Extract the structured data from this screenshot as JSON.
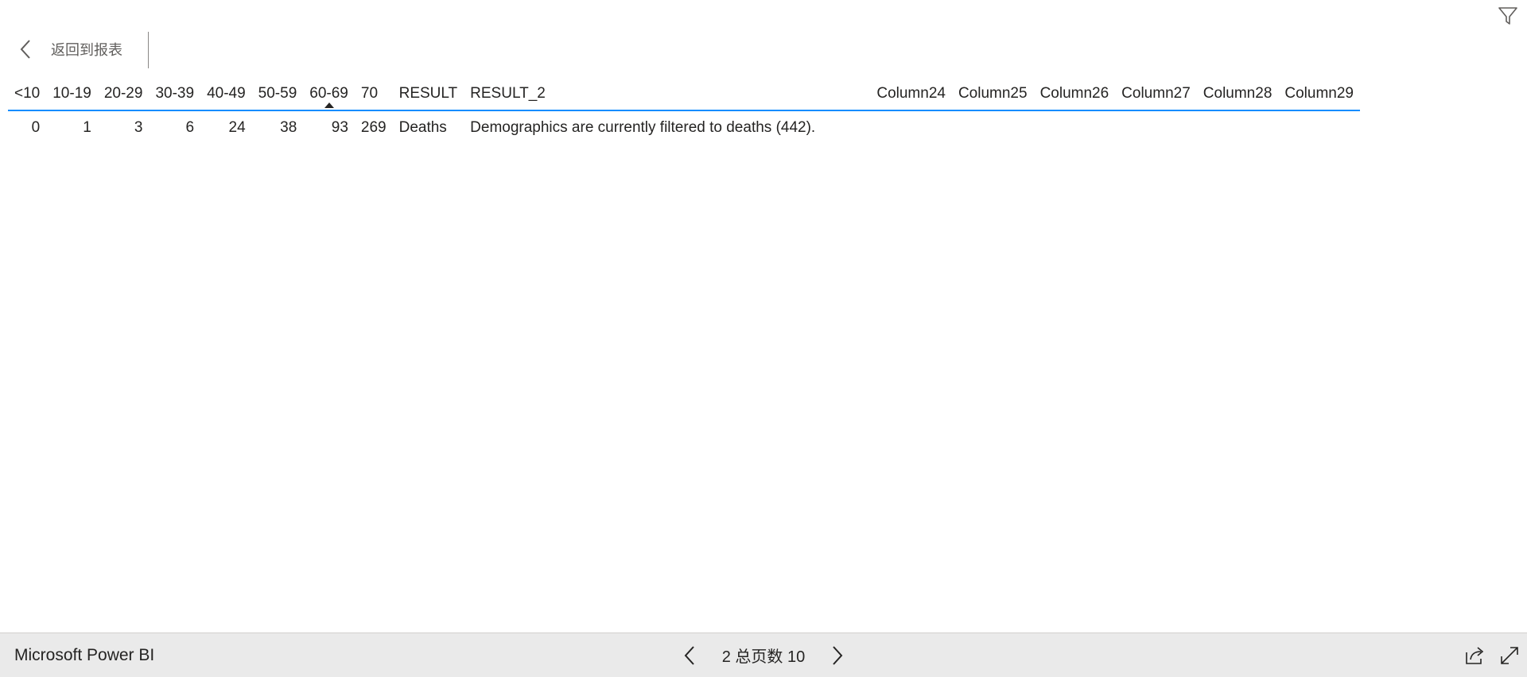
{
  "header": {
    "back_label": "返回到报表",
    "icons": {
      "back": "chevron-left-icon",
      "filter": "filter-icon"
    }
  },
  "table": {
    "columns": [
      "<10",
      "10-19",
      "20-29",
      "30-39",
      "40-49",
      "50-59",
      "60-69",
      "70",
      "RESULT",
      "RESULT_2",
      "",
      "Column24",
      "Column25",
      "Column26",
      "Column27",
      "Column28",
      "Column29"
    ],
    "sorted_column": "60-69",
    "rows": [
      [
        "0",
        "1",
        "3",
        "6",
        "24",
        "38",
        "93",
        "269",
        "Deaths",
        "Demographics are currently filtered to deaths (442).",
        "",
        "",
        "",
        "",
        "",
        "",
        ""
      ]
    ]
  },
  "footer": {
    "brand": "Microsoft Power BI",
    "page_text": "2 总页数 10",
    "icons": {
      "prev": "chevron-left-icon",
      "next": "chevron-right-icon",
      "share": "share-icon",
      "fullscreen": "expand-icon"
    }
  },
  "colors": {
    "accent": "#118dff",
    "footer_bg": "#eaeaea",
    "text": "#252423"
  }
}
